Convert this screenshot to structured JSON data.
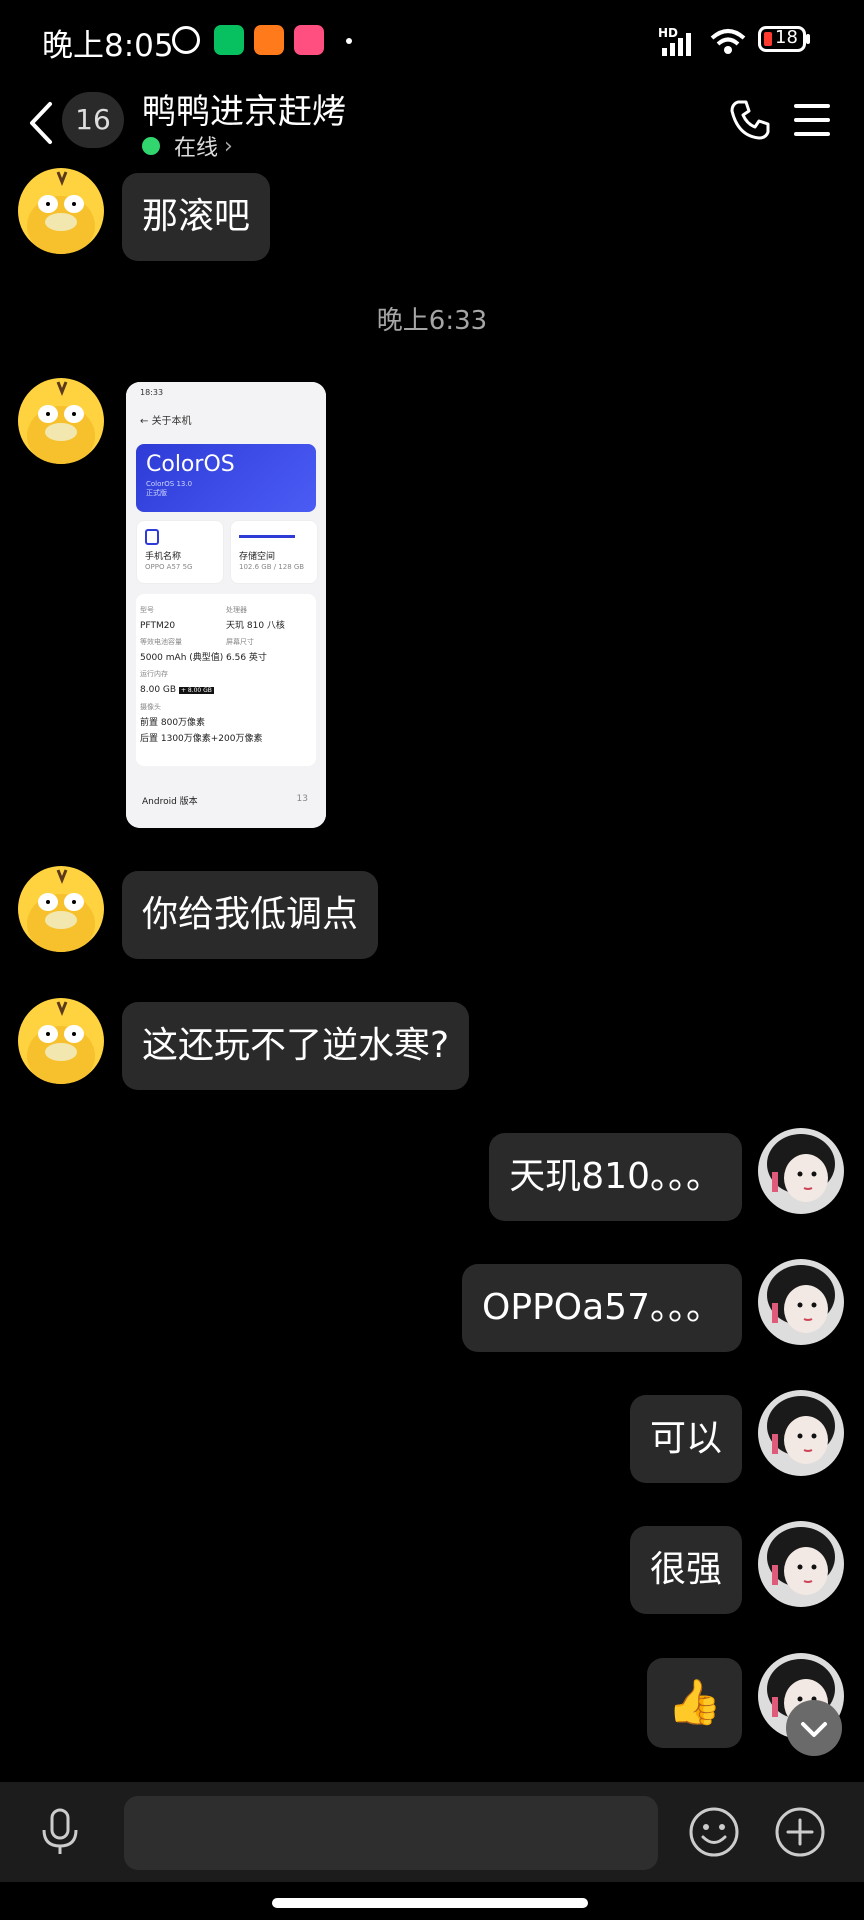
{
  "status_bar": {
    "time": "晚上8:05",
    "battery": "18",
    "network_label": "HD"
  },
  "header": {
    "unread_count": "16",
    "title": "鸭鸭进京赶烤",
    "status": "在线",
    "status_chevron": "›"
  },
  "messages": [
    {
      "side": "left",
      "type": "text",
      "text": "那滚吧"
    },
    {
      "side": "center",
      "type": "time",
      "text": "晚上6:33"
    },
    {
      "side": "left",
      "type": "image"
    },
    {
      "side": "left",
      "type": "text",
      "text": "你给我低调点"
    },
    {
      "side": "left",
      "type": "text",
      "text": "这还玩不了逆水寒?"
    },
    {
      "side": "right",
      "type": "text",
      "text": "天玑810。。。"
    },
    {
      "side": "right",
      "type": "text",
      "text": "OPPOa57。。。"
    },
    {
      "side": "right",
      "type": "text",
      "text": "可以"
    },
    {
      "side": "right",
      "type": "text",
      "text": "很强"
    },
    {
      "side": "right",
      "type": "emoji",
      "text": "👍"
    }
  ],
  "screenshot_preview": {
    "status_time": "18:33",
    "nav_title": "关于本机",
    "brand": "ColorOS",
    "version_line1": "ColorOS 13.0",
    "version_line2": "正式版",
    "card1_label": "手机名称",
    "card1_value": "OPPO A57 5G",
    "card2_label": "存储空间",
    "card2_value": "102.6 GB / 128 GB",
    "spec_model_label": "型号",
    "spec_model": "PFTM20",
    "spec_cpu_label": "处理器",
    "spec_cpu": "天玑 810 八核",
    "spec_battery_label": "等效电池容量",
    "spec_battery": "5000 mAh (典型值)",
    "spec_screen_label": "屏幕尺寸",
    "spec_screen": "6.56 英寸",
    "spec_ram_label": "运行内存",
    "spec_ram": "8.00 GB",
    "spec_ram_extra": "+ 8.00 GB",
    "spec_camera_label": "摄像头",
    "spec_camera_front": "前置 800万像素",
    "spec_camera_rear": "后置 1300万像素+200万像素",
    "android_label": "Android 版本",
    "android_value": "13"
  },
  "input": {
    "placeholder": ""
  },
  "colors": {
    "background": "#000000",
    "bubble": "#2a2a2a",
    "online": "#32d66f",
    "input_bar": "#1c1c1c"
  }
}
